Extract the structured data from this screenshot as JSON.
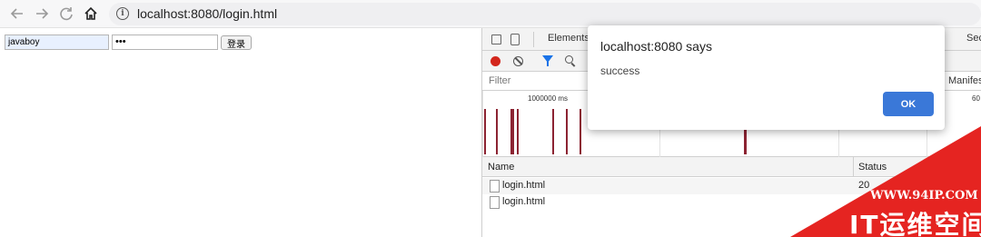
{
  "browser": {
    "url": "localhost:8080/login.html",
    "info_glyph": "i",
    "icons": [
      "back-arrow-icon",
      "forward-arrow-icon",
      "reload-icon",
      "home-icon",
      "info-icon"
    ]
  },
  "login_form": {
    "username_value": "javaboy",
    "password_value": "•••",
    "submit_label": "登录"
  },
  "devtools": {
    "tabs": {
      "elements": "Elements",
      "security": "Sec"
    },
    "filter_label": "Filter",
    "manifest_label": "Manifes",
    "timeline": {
      "tick_label": "1000000 ms",
      "tick_label_right": "60"
    },
    "columns": {
      "name": "Name",
      "status": "Status"
    },
    "requests": [
      {
        "name": "login.html",
        "status": "20"
      },
      {
        "name": "login.html",
        "status": ""
      }
    ],
    "record_color": "#d3261c",
    "filter_color": "#1a73e8"
  },
  "dialog": {
    "title": "localhost:8080 says",
    "message": "success",
    "ok_label": "OK",
    "ok_color": "#3a78d8"
  },
  "watermark": {
    "url": "WWW.94IP.COM",
    "name": "IT运维空间",
    "color": "#e52421"
  }
}
